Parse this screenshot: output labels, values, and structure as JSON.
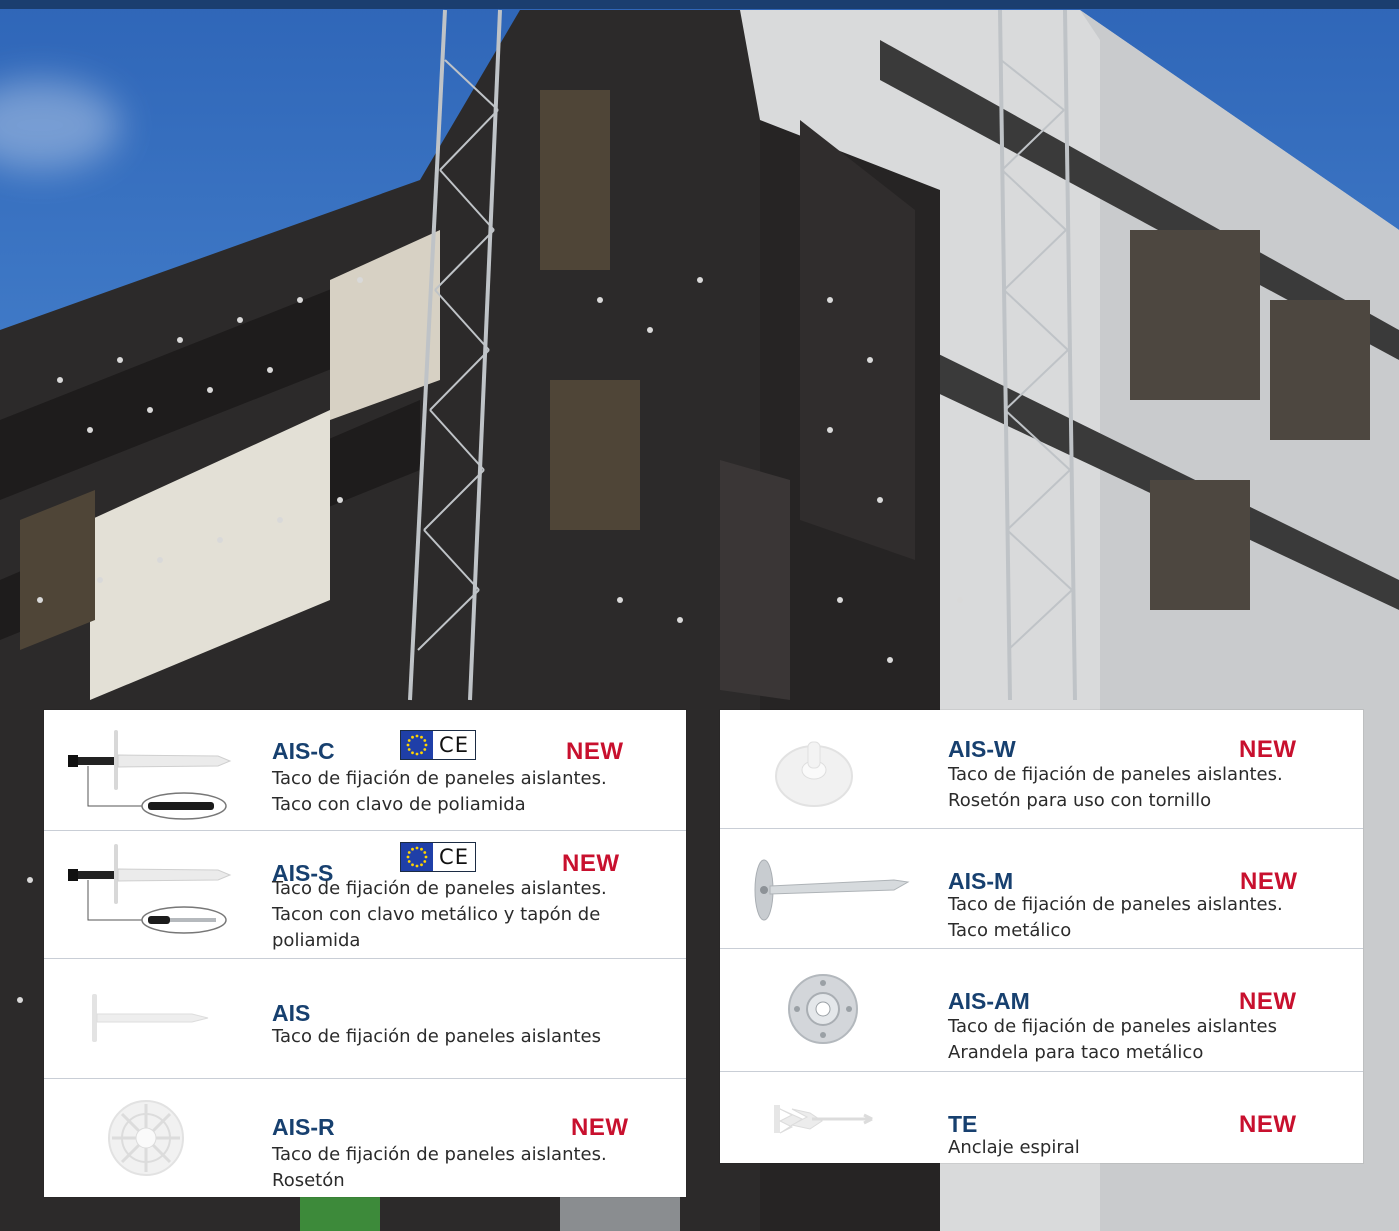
{
  "colors": {
    "title": "#17406f",
    "new_badge": "#c8102e",
    "text": "#2b2b2b",
    "divider": "#c9ced6"
  },
  "left_products": [
    {
      "code": "AIS-C",
      "new": "NEW",
      "ce": true,
      "lines": [
        "Taco de fijación de paneles aislantes.",
        "Taco con clavo de poliamida"
      ]
    },
    {
      "code": "AIS-S",
      "new": "NEW",
      "ce": true,
      "lines": [
        "Taco de fijación de paneles aislantes.",
        "Tacon con clavo metálico y tapón de",
        "poliamida"
      ]
    },
    {
      "code": "AIS",
      "new": "",
      "ce": false,
      "lines": [
        "Taco de fijación de paneles aislantes"
      ]
    },
    {
      "code": "AIS-R",
      "new": "NEW",
      "ce": false,
      "lines": [
        "Taco de fijación de paneles aislantes.",
        "Rosetón"
      ]
    }
  ],
  "right_products": [
    {
      "code": "AIS-W",
      "new": "NEW",
      "lines": [
        "Taco de fijación de paneles aislantes.",
        "Rosetón para uso con tornillo"
      ]
    },
    {
      "code": "AIS-M",
      "new": "NEW",
      "lines": [
        "Taco de fijación de paneles aislantes.",
        "Taco metálico"
      ]
    },
    {
      "code": "AIS-AM",
      "new": "NEW",
      "lines": [
        "Taco de fijación de paneles aislantes",
        "Arandela para taco metálico"
      ]
    },
    {
      "code": "TE",
      "new": "NEW",
      "lines": [
        "Anclaje espiral"
      ]
    }
  ],
  "ce_mark": "CE",
  "icons": [
    "ais-c-anchor-icon",
    "ais-s-anchor-icon",
    "ais-anchor-icon",
    "ais-r-rosette-icon",
    "ais-w-rosette-icon",
    "ais-m-metal-anchor-icon",
    "ais-am-washer-icon",
    "te-spiral-anchor-icon"
  ]
}
